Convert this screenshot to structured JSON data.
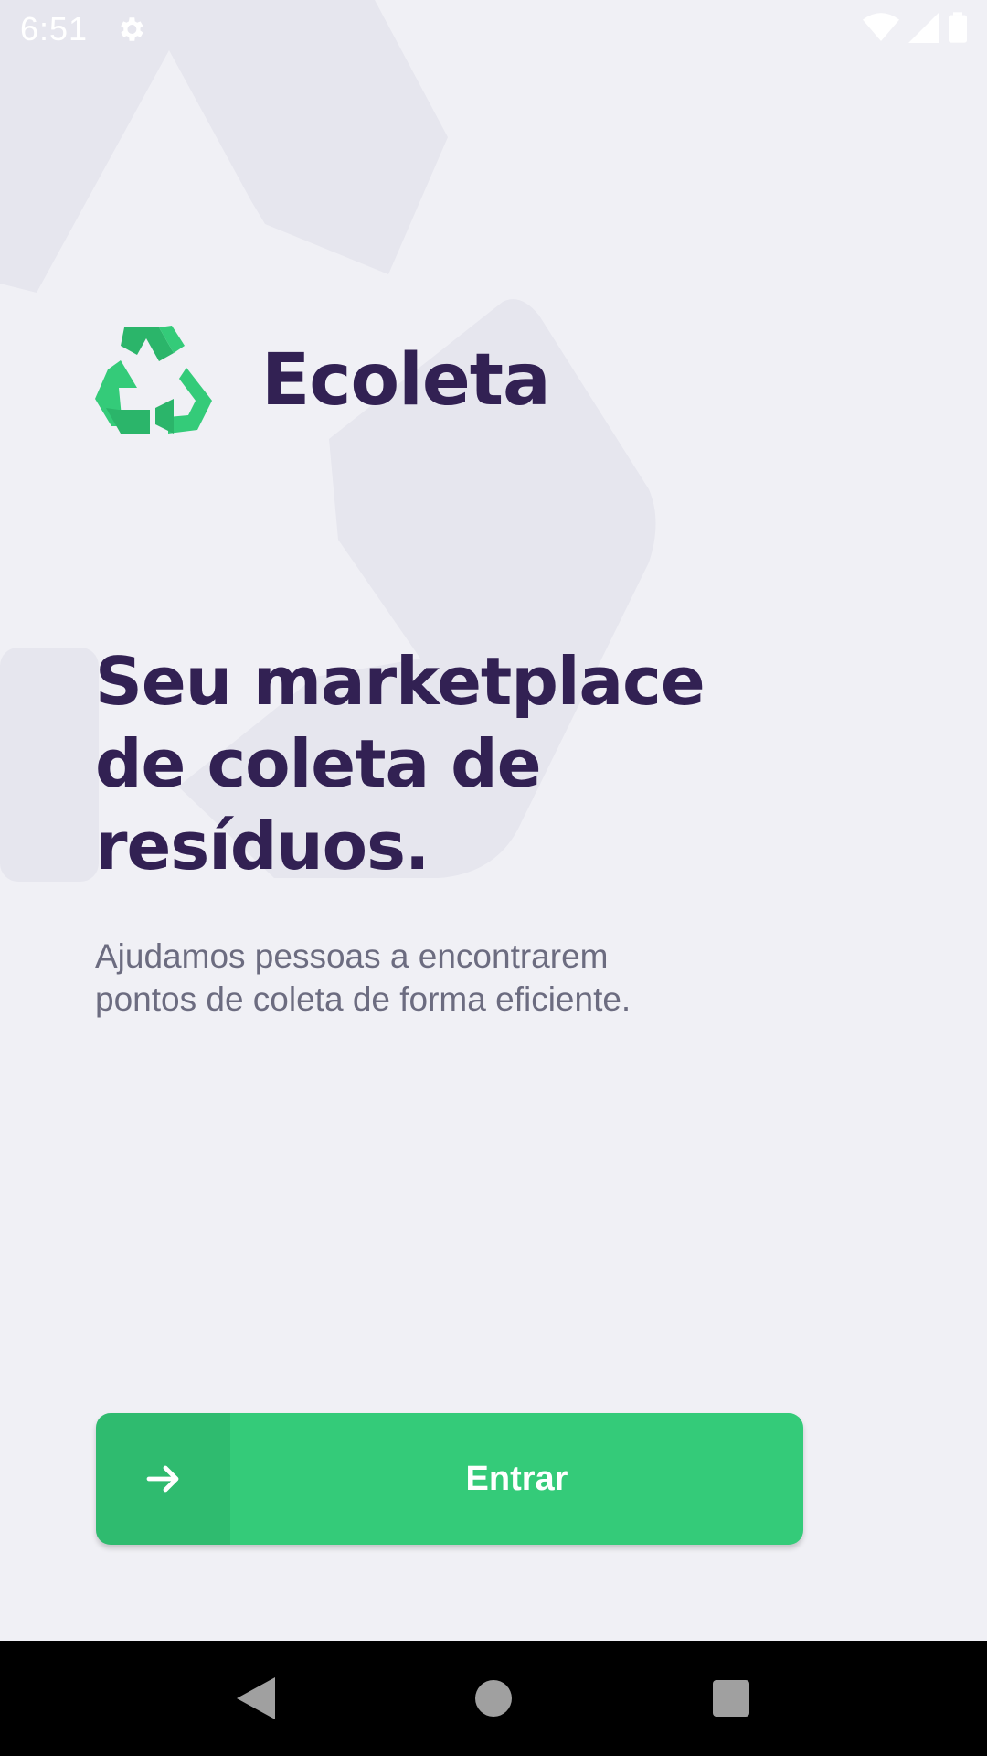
{
  "status_bar": {
    "time": "6:51",
    "icons": [
      "gear-icon",
      "wifi-icon",
      "signal-icon",
      "battery-icon"
    ]
  },
  "app": {
    "name": "Ecoleta",
    "logo_icon": "recycle-icon"
  },
  "hero": {
    "headline_line1": "Seu marketplace",
    "headline_line2": "de coleta de",
    "headline_line3": "resíduos.",
    "subtitle": "Ajudamos pessoas a encontrarem\n pontos de coleta de forma eficiente."
  },
  "enter_button": {
    "label": "Entrar",
    "icon": "arrow-right-icon"
  },
  "nav_bar": {
    "icons": [
      "back-icon",
      "home-icon",
      "recents-icon"
    ]
  },
  "colors": {
    "background": "#f0f0f5",
    "title": "#322153",
    "text": "#6c6c80",
    "accent": "#34cb79"
  }
}
